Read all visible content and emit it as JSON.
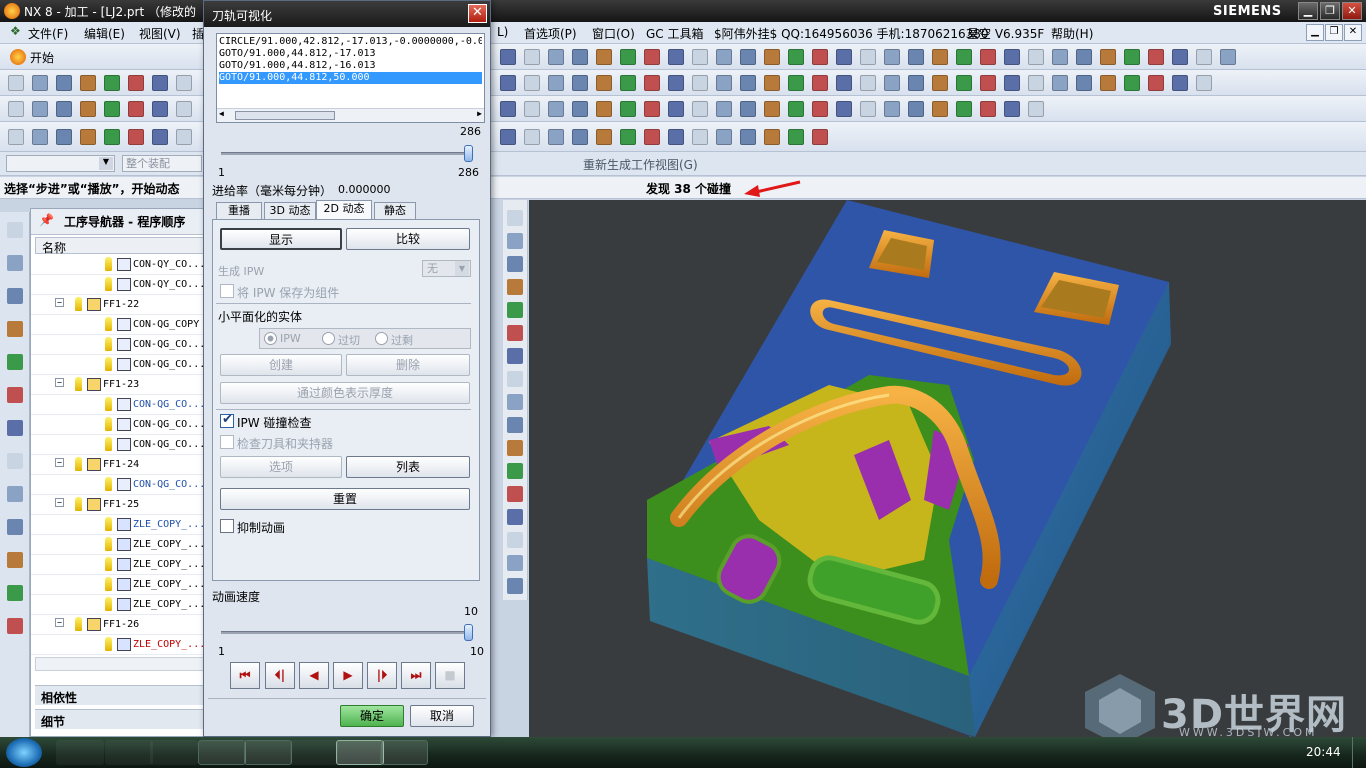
{
  "window": {
    "title": "NX 8 - 加工 - [LJ2.prt （修改的",
    "brand": "SIEMENS",
    "min": "▁",
    "restore": "❐",
    "close": "✕"
  },
  "menubar": {
    "left": [
      {
        "label": "文件(F)"
      },
      {
        "label": "编辑(E)"
      },
      {
        "label": "视图(V)"
      },
      {
        "label": "插"
      }
    ],
    "right": [
      {
        "label": "L)"
      },
      {
        "label": "首选项(P)"
      },
      {
        "label": "窗口(O)"
      },
      {
        "label": "GC 工具箱"
      },
      {
        "label": "$阿伟外挂$ QQ:164956036 手机:18706216380"
      },
      {
        "label": "星空 V6.935F"
      },
      {
        "label": "帮助(H)"
      }
    ]
  },
  "toolbar": {
    "start_label": "开始",
    "assembly_placeholder": "整个装配",
    "regen_label": "重新生成工作视图(G)"
  },
  "cue": {
    "left": "选择“步进”或“播放”，开始动态",
    "right": "发现 38 个碰撞"
  },
  "navigator": {
    "title": "工序导航器 - 程序顺序",
    "column": "名称",
    "rows": [
      {
        "level": 2,
        "name": "CON-QY_CO...",
        "color": "#000000",
        "kind": "op"
      },
      {
        "level": 2,
        "name": "CON-QY_CO...",
        "color": "#000000",
        "kind": "op"
      },
      {
        "level": 1,
        "name": "FF1-22",
        "color": "#000000",
        "kind": "group"
      },
      {
        "level": 2,
        "name": "CON-QG_COPY",
        "color": "#000000",
        "kind": "op"
      },
      {
        "level": 2,
        "name": "CON-QG_CO...",
        "color": "#000000",
        "kind": "op"
      },
      {
        "level": 2,
        "name": "CON-QG_CO...",
        "color": "#000000",
        "kind": "op"
      },
      {
        "level": 1,
        "name": "FF1-23",
        "color": "#000000",
        "kind": "group"
      },
      {
        "level": 2,
        "name": "CON-QG_CO...",
        "color": "#1f4fa8",
        "kind": "op"
      },
      {
        "level": 2,
        "name": "CON-QG_CO...",
        "color": "#000000",
        "kind": "op"
      },
      {
        "level": 2,
        "name": "CON-QG_CO...",
        "color": "#000000",
        "kind": "op"
      },
      {
        "level": 1,
        "name": "FF1-24",
        "color": "#000000",
        "kind": "group"
      },
      {
        "level": 2,
        "name": "CON-QG_CO...",
        "color": "#1f4fa8",
        "kind": "op"
      },
      {
        "level": 1,
        "name": "FF1-25",
        "color": "#000000",
        "kind": "group"
      },
      {
        "level": 2,
        "name": "ZLE_COPY_...",
        "color": "#1f4fa8",
        "kind": "zle"
      },
      {
        "level": 2,
        "name": "ZLE_COPY_...",
        "color": "#000000",
        "kind": "zle"
      },
      {
        "level": 2,
        "name": "ZLE_COPY_...",
        "color": "#000000",
        "kind": "zle"
      },
      {
        "level": 2,
        "name": "ZLE_COPY_...",
        "color": "#000000",
        "kind": "zle"
      },
      {
        "level": 2,
        "name": "ZLE_COPY_...",
        "color": "#000000",
        "kind": "zle"
      },
      {
        "level": 1,
        "name": "FF1-26",
        "color": "#000000",
        "kind": "group"
      },
      {
        "level": 2,
        "name": "ZLE_COPY_...",
        "color": "#c00000",
        "kind": "zle"
      }
    ],
    "dependencies": "相依性",
    "details": "细节"
  },
  "dialog": {
    "title": "刀轨可视化",
    "close": "✕",
    "listing": [
      "CIRCLE/91.000,42.812,-17.013,-0.0000000,-0.0",
      "GOTO/91.000,44.812,-17.013",
      "GOTO/91.000,44.812,-16.013",
      "GOTO/91.000,44.812,50.000"
    ],
    "selected_line": 3,
    "slider1": {
      "max_top": "286",
      "min": "1",
      "max": "286",
      "value": 1.0
    },
    "feed_label": "进给率（毫米每分钟）",
    "feed_value": "0.000000",
    "tabs": [
      "重播",
      "3D 动态",
      "2D 动态",
      "静态"
    ],
    "active_tab": 2,
    "show": "显示",
    "compare": "比较",
    "gen_ipw": "生成 IPW",
    "gen_ipw_value": "无",
    "save_ipw": "将 IPW 保存为组件",
    "facet_title": "小平面化的实体",
    "radios": [
      "IPW",
      "过切",
      "过剩"
    ],
    "create": "创建",
    "delete": "删除",
    "thickness": "通过颜色表示厚度",
    "ipw_check": "IPW 碰撞检查",
    "ipw_checked": true,
    "check_holder": "检查刀具和夹持器",
    "options": "选项",
    "list": "列表",
    "reset": "重置",
    "suppress": "抑制动画",
    "speed_label": "动画速度",
    "slider2": {
      "max_top": "10",
      "min": "1",
      "max": "10",
      "value": 1.0
    },
    "playback": [
      "⏮",
      "⏴|",
      "◀",
      "▶",
      "|⏵",
      "⏭",
      "■"
    ],
    "ok": "确定",
    "cancel": "取消"
  },
  "watermark": {
    "cn": "3D世界网",
    "url": "WWW.3DSJW.COM"
  },
  "taskbar": {
    "clock": "20:44"
  },
  "colors": {
    "part_blue": "#2f55a8",
    "part_orange": "#e2871e",
    "part_purple": "#9a2fae",
    "part_green": "#3c8f1c",
    "part_yellow": "#c7b51c",
    "side_blue": "#2f6fa0"
  }
}
